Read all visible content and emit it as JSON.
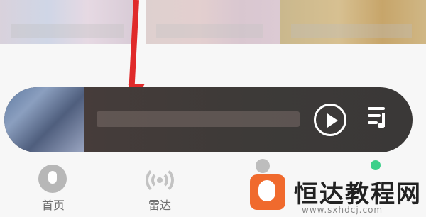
{
  "colors": {
    "player_bg": "#3d3a38",
    "arrow": "#e02a2a",
    "accent_green": "#3cd08a",
    "watermark_orange": "#f06a2d"
  },
  "mini_player": {
    "song_title": "",
    "play_icon": "play-circle",
    "playlist_icon": "playlist-music"
  },
  "tabs": [
    {
      "label": "首页",
      "icon": "music-note-circle"
    },
    {
      "label": "雷达",
      "icon": "radar-broadcast"
    }
  ],
  "watermark": {
    "text": "恒达教程网",
    "url": "www.sxhdcj.com"
  }
}
